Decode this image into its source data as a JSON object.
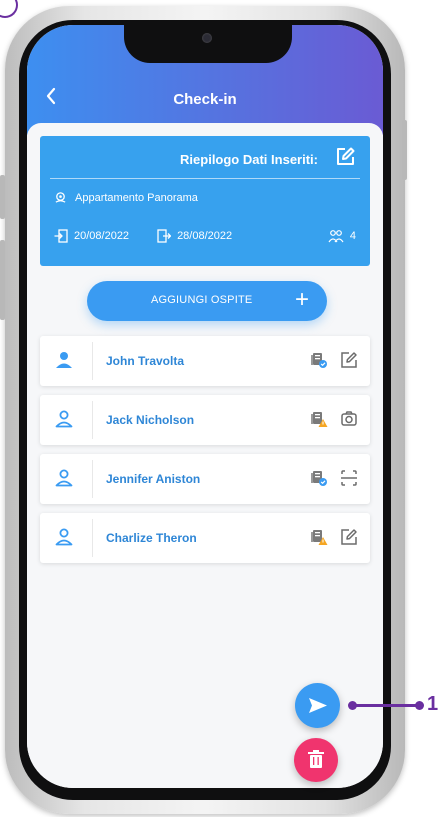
{
  "header": {
    "title": "Check-in",
    "back_icon": "chevron-left-icon"
  },
  "summary": {
    "title": "Riepilogo Dati Inseriti:",
    "apartment": "Appartamento Panorama",
    "checkin_date": "20/08/2022",
    "checkout_date": "28/08/2022",
    "guests_count": "4",
    "color": "#37a1ee"
  },
  "actions": {
    "add_guest_label": "AGGIUNGI OSPITE",
    "add_guest_plus": "+"
  },
  "guests": [
    {
      "name": "John Travolta",
      "avatar": "user-filled-icon",
      "doc_status": "ok",
      "action": "edit-icon"
    },
    {
      "name": "Jack Nicholson",
      "avatar": "user-outline-icon",
      "doc_status": "warning",
      "action": "camera-icon"
    },
    {
      "name": "Jennifer Aniston",
      "avatar": "user-outline-icon",
      "doc_status": "ok",
      "action": "scan-icon"
    },
    {
      "name": "Charlize Theron",
      "avatar": "user-outline-icon",
      "doc_status": "warning",
      "action": "edit-icon"
    }
  ],
  "colors": {
    "accent": "#3a9bf2",
    "delete": "#f0346e",
    "header_start": "#3d8ff0",
    "header_end": "#6a5bd4",
    "callout": "#6a2fa0"
  },
  "callout": {
    "number": "1"
  }
}
